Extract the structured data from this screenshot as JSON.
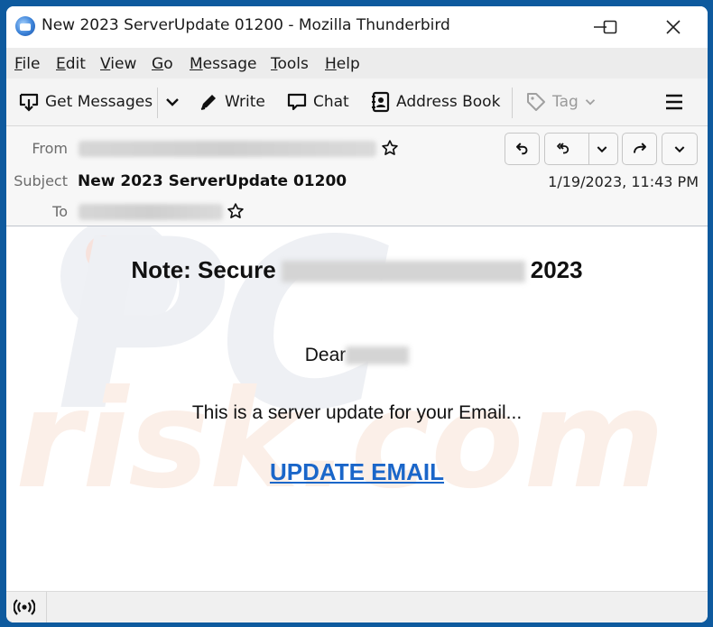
{
  "window": {
    "title": "New 2023 ServerUpdate 01200 - Mozilla Thunderbird",
    "app_icon": "thunderbird-logo",
    "controls": [
      "minimize",
      "maximize",
      "close"
    ]
  },
  "menubar": {
    "items": [
      {
        "accel": "F",
        "rest": "ile"
      },
      {
        "accel": "E",
        "rest": "dit"
      },
      {
        "accel": "V",
        "rest": "iew"
      },
      {
        "accel": "G",
        "rest": "o"
      },
      {
        "accel": "M",
        "rest": "essage"
      },
      {
        "accel": "T",
        "rest": "ools"
      },
      {
        "accel": "H",
        "rest": "elp"
      }
    ]
  },
  "toolbar": {
    "get_messages": "Get Messages",
    "write": "Write",
    "chat": "Chat",
    "address_book": "Address Book",
    "tag": "Tag"
  },
  "header": {
    "from_label": "From",
    "subject_label": "Subject",
    "to_label": "To",
    "subject": "New 2023 ServerUpdate 01200",
    "date": "1/19/2023, 11:43 PM",
    "actions": [
      "reply",
      "reply-all",
      "reply-all-menu",
      "forward",
      "more"
    ]
  },
  "message": {
    "title_prefix": "Note: Secure",
    "title_suffix": "2023",
    "greeting": "Dear",
    "body": "This is a server update for your Email...",
    "link": "UPDATE EMAIL",
    "link_color": "#1a66c9"
  },
  "watermark": {
    "line1": "PC",
    "line2": "risk.com"
  }
}
